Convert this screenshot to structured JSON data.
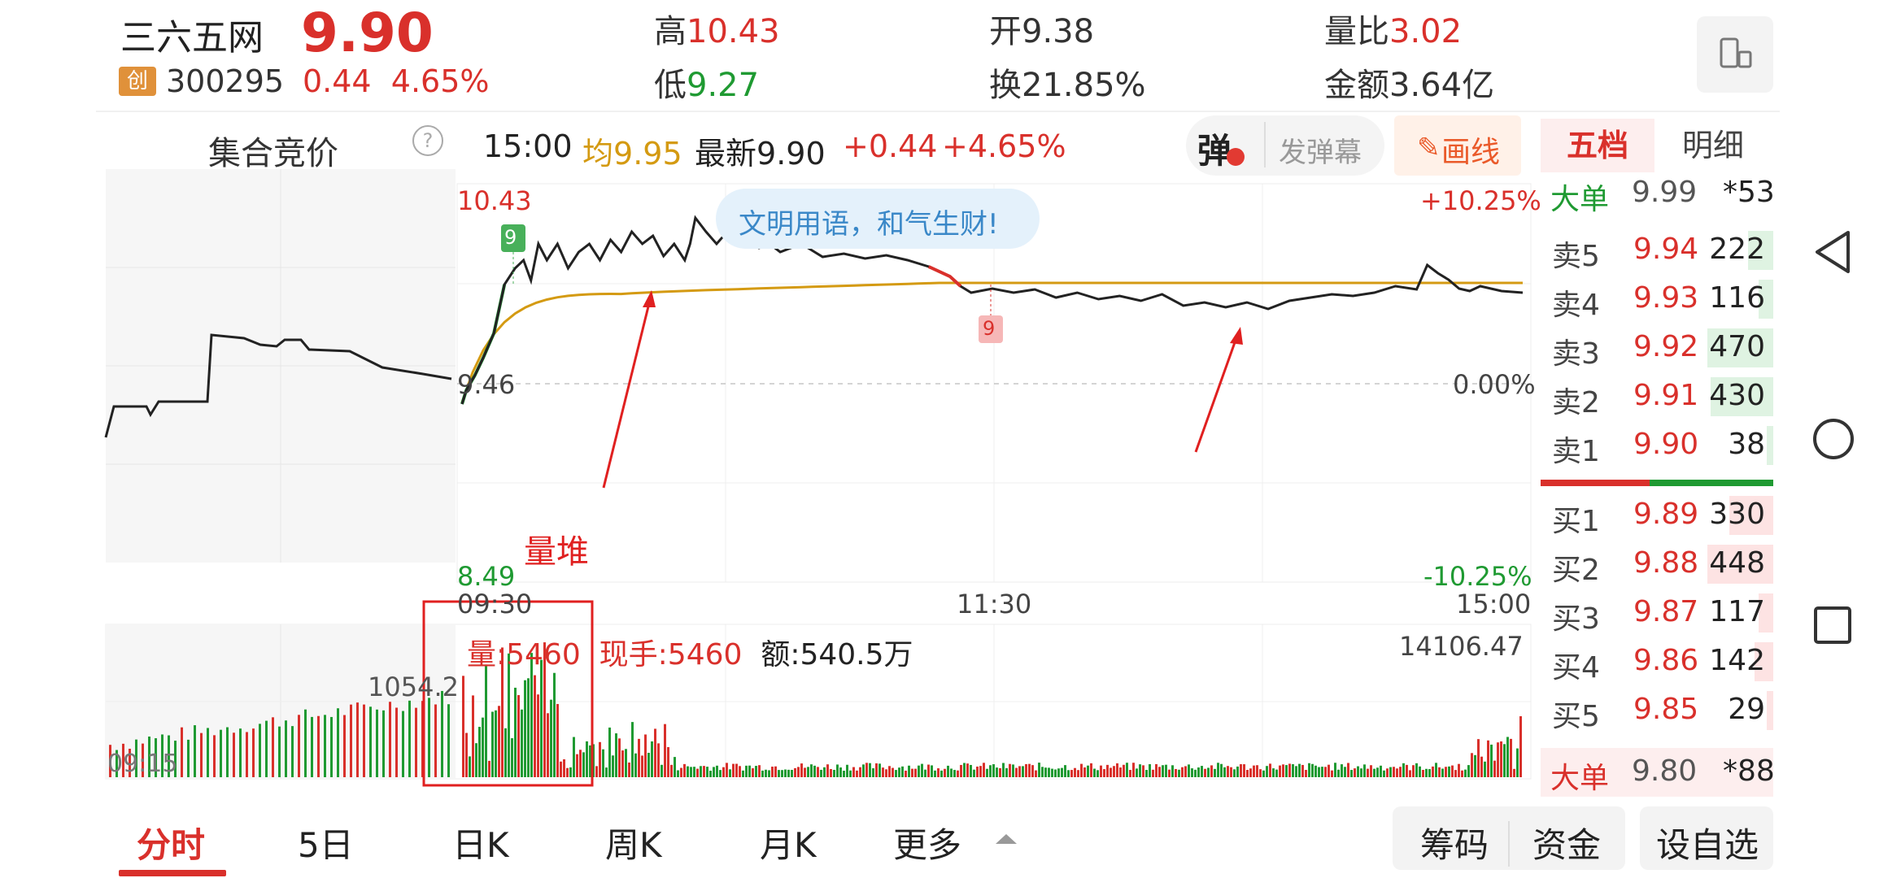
{
  "header": {
    "stock_name": "三六五网",
    "price": "9.90",
    "board_badge": "创",
    "stock_code": "300295",
    "change": "0.44",
    "change_pct": "4.65%",
    "high_label": "高",
    "high": "10.43",
    "low_label": "低",
    "low": "9.27",
    "open_label": "开",
    "open": "9.38",
    "turnover_label": "换",
    "turnover": "21.85%",
    "vol_ratio_label": "量比",
    "vol_ratio": "3.02",
    "amount_label": "金额",
    "amount": "3.64亿"
  },
  "toolbar": {
    "auction_label": "集合竞价",
    "help": "?",
    "time": "15:00",
    "avg_label": "均",
    "avg": "9.95",
    "latest_label": "最新",
    "latest": "9.90",
    "change": "+0.44",
    "change_pct": "+4.65%",
    "danmu_icon": "弹",
    "send_danmu": "发弹幕",
    "draw_line": "画线"
  },
  "chart": {
    "max_price": "10.43",
    "min_price": "8.49",
    "base_price": "9.46",
    "max_pct": "+10.25%",
    "zero_pct": "0.00%",
    "min_pct": "-10.25%",
    "danmu_bubble": "文明用语，和气生财!",
    "marker_up": "9",
    "marker_down": "9",
    "annotation_volume_pile": "量堆",
    "auction_time": "09:15",
    "time_labels": [
      "09:30",
      "11:30",
      "15:00"
    ],
    "volume_info": {
      "vol_label": "量:",
      "vol": "5460",
      "hand_label": "现手:",
      "hand": "5460",
      "amount_label": "额:",
      "amount": "540.5万"
    },
    "volume_max": "14106.47",
    "auction_volume_label": "1054.2",
    "colors": {
      "up": "#d9302b",
      "down": "#1f9a32",
      "avg": "#d49a12",
      "price": "#222222"
    }
  },
  "orderbook": {
    "tab_five": "五档",
    "tab_detail": "明细",
    "big_top": {
      "label": "大单",
      "price": "9.99",
      "vol": "*53"
    },
    "sells": [
      {
        "label": "卖5",
        "price": "9.94",
        "vol": "222",
        "bar": 0.35
      },
      {
        "label": "卖4",
        "price": "9.93",
        "vol": "116",
        "bar": 0.2
      },
      {
        "label": "卖3",
        "price": "9.92",
        "vol": "470",
        "bar": 0.9
      },
      {
        "label": "卖2",
        "price": "9.91",
        "vol": "430",
        "bar": 0.85
      },
      {
        "label": "卖1",
        "price": "9.90",
        "vol": "38",
        "bar": 0.05
      }
    ],
    "buys": [
      {
        "label": "买1",
        "price": "9.89",
        "vol": "330",
        "bar": 0.6
      },
      {
        "label": "买2",
        "price": "9.88",
        "vol": "448",
        "bar": 0.9
      },
      {
        "label": "买3",
        "price": "9.87",
        "vol": "117",
        "bar": 0.2
      },
      {
        "label": "买4",
        "price": "9.86",
        "vol": "142",
        "bar": 0.25
      },
      {
        "label": "买5",
        "price": "9.85",
        "vol": "29",
        "bar": 0.05
      }
    ],
    "big_bottom": {
      "label": "大单",
      "price": "9.80",
      "vol": "*88"
    }
  },
  "bottom_tabs": {
    "intraday": "分时",
    "five_day": "5日",
    "day_k": "日K",
    "week_k": "周K",
    "month_k": "月K",
    "more": "更多",
    "chips": "筹码",
    "funds": "资金",
    "add_watch": "设自选"
  }
}
